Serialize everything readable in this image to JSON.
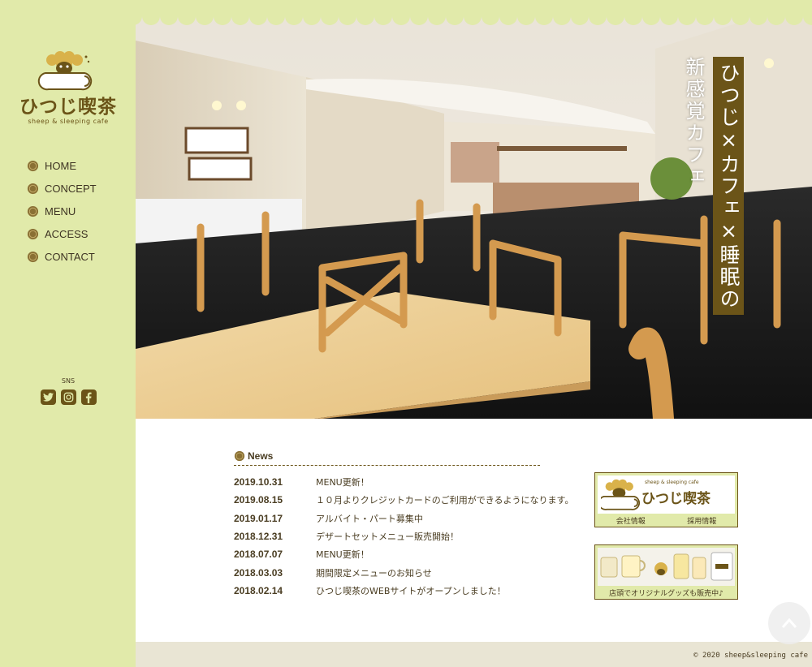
{
  "brand": {
    "name": "ひつじ喫茶",
    "tagline": "sheep & sleeping cafe"
  },
  "nav": [
    {
      "label": "HOME"
    },
    {
      "label": "CONCEPT"
    },
    {
      "label": "MENU"
    },
    {
      "label": "ACCESS"
    },
    {
      "label": "CONTACT"
    }
  ],
  "sns": {
    "label": "SNS",
    "icons": [
      "twitter-icon",
      "instagram-icon",
      "facebook-icon"
    ]
  },
  "hero": {
    "catch_main": "ひつじ×カフェ×睡眠の",
    "catch_sub": "新感覚カフェ"
  },
  "news": {
    "title": "News",
    "items": [
      {
        "date": "2019.10.31",
        "text": "MENU更新！"
      },
      {
        "date": "2019.08.15",
        "text": "１０月よりクレジットカードのご利用ができるようになります。"
      },
      {
        "date": "2019.01.17",
        "text": "アルバイト・パート募集中"
      },
      {
        "date": "2018.12.31",
        "text": "デザートセットメニュー販売開始！"
      },
      {
        "date": "2018.07.07",
        "text": "MENU更新！"
      },
      {
        "date": "2018.03.03",
        "text": "期間限定メニューのお知らせ"
      },
      {
        "date": "2018.02.14",
        "text": "ひつじ喫茶のWEBサイトがオープンしました！"
      }
    ]
  },
  "banners": {
    "company": {
      "name": "ひつじ喫茶",
      "sub": "sheep & sleeping cafe",
      "link1": "会社情報",
      "link2": "採用情報"
    },
    "goods": {
      "caption": "店頭でオリジナルグッズも販売中♪"
    }
  },
  "footer": {
    "copyright": "© 2020 sheep&sleeping cafe"
  },
  "colors": {
    "sidebar": "#e1eaaa",
    "brown": "#6b5418",
    "footer": "#e9e5d4"
  }
}
